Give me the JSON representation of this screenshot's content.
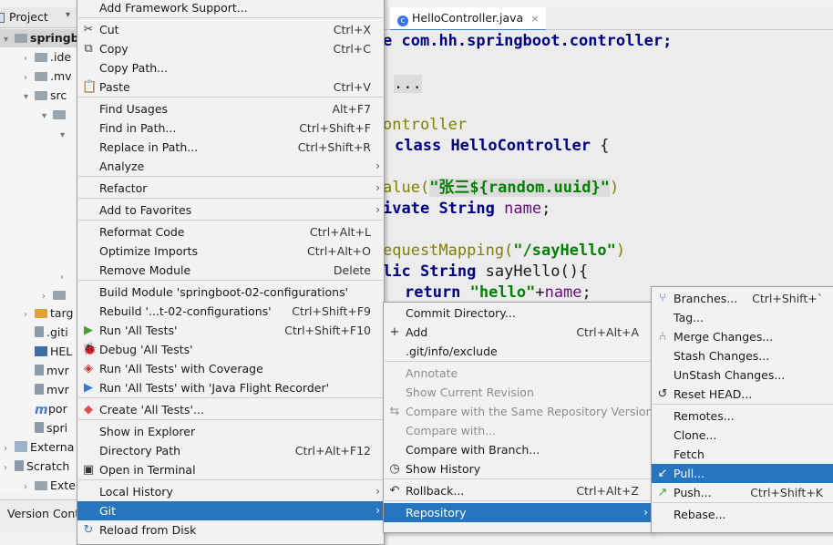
{
  "project_panel": {
    "title": "Project",
    "tree": [
      {
        "label": "springb",
        "arrow": "▾",
        "icon": "folder",
        "bold": true,
        "selected": true
      },
      {
        "label": ".ide",
        "arrow": "›",
        "icon": "folder"
      },
      {
        "label": ".mv",
        "arrow": "›",
        "icon": "folder"
      },
      {
        "label": "src",
        "arrow": "▾",
        "icon": "folder"
      },
      {
        "label": "",
        "arrow": "▾",
        "icon": "folder"
      },
      {
        "label": "",
        "arrow": "▾",
        "icon": ""
      },
      {
        "label": "",
        "arrow": "›",
        "icon": ""
      },
      {
        "label": "",
        "arrow": "›",
        "icon": "folder"
      },
      {
        "label": "targ",
        "arrow": "›",
        "icon": "folder-orange"
      },
      {
        "label": ".giti",
        "arrow": "",
        "icon": "file"
      },
      {
        "label": "HEL",
        "arrow": "",
        "icon": "markdown"
      },
      {
        "label": "mvr",
        "arrow": "",
        "icon": "file"
      },
      {
        "label": "mvr",
        "arrow": "",
        "icon": "file"
      },
      {
        "label": "por",
        "arrow": "",
        "icon": "maven"
      },
      {
        "label": "spri",
        "arrow": "",
        "icon": "file"
      },
      {
        "label": "Externa",
        "arrow": "›",
        "icon": "library"
      },
      {
        "label": "Scratch",
        "arrow": "›",
        "icon": "scratch"
      },
      {
        "label": "Exte",
        "arrow": "›",
        "icon": "folder"
      }
    ],
    "bottom_tab": "Version Cont"
  },
  "editor": {
    "tab_label": "HelloController.java",
    "tab_close": "×",
    "package_kw": "e",
    "package_name": "com.hh.springboot.controller;",
    "import_fold": "...",
    "l1": "ontroller",
    "l2_kw": "class",
    "l2_name": "HelloController",
    "l2_brace": "{",
    "l3_ann": "alue(",
    "l3_str": "\"张三${random.uuid}\"",
    "l3_end": ")",
    "l4_kw": "ivate",
    "l4_type": "String",
    "l4_field": "name",
    "l4_end": ";",
    "l5_ann": "equestMapping(",
    "l5_str": "\"/sayHello\"",
    "l5_end": ")",
    "l6_kw": "lic",
    "l6_type": "String",
    "l6_rest": "sayHello(){",
    "l7_kw": "return",
    "l7_str": "\"hello\"",
    "l7_plus": "+",
    "l7_field": "name",
    "l7_end": ";"
  },
  "context_menu": {
    "items": [
      {
        "label": "Add Framework Support...",
        "shortcut": "",
        "icon": ""
      },
      {
        "label": "Cut",
        "shortcut": "Ctrl+X",
        "icon": "scissors-icon"
      },
      {
        "label": "Copy",
        "shortcut": "Ctrl+C",
        "icon": "copy-icon"
      },
      {
        "label": "Copy Path...",
        "shortcut": "",
        "icon": ""
      },
      {
        "label": "Paste",
        "shortcut": "Ctrl+V",
        "icon": "paste-icon"
      },
      {
        "label": "Find Usages",
        "shortcut": "Alt+F7",
        "icon": ""
      },
      {
        "label": "Find in Path...",
        "shortcut": "Ctrl+Shift+F",
        "icon": ""
      },
      {
        "label": "Replace in Path...",
        "shortcut": "Ctrl+Shift+R",
        "icon": ""
      },
      {
        "label": "Analyze",
        "shortcut": "",
        "icon": "",
        "submenu": true
      },
      {
        "label": "Refactor",
        "shortcut": "",
        "icon": "",
        "submenu": true
      },
      {
        "label": "Add to Favorites",
        "shortcut": "",
        "icon": "",
        "submenu": true
      },
      {
        "label": "Reformat Code",
        "shortcut": "Ctrl+Alt+L",
        "icon": ""
      },
      {
        "label": "Optimize Imports",
        "shortcut": "Ctrl+Alt+O",
        "icon": ""
      },
      {
        "label": "Remove Module",
        "shortcut": "Delete",
        "icon": ""
      },
      {
        "label": "Build Module 'springboot-02-configurations'",
        "shortcut": "",
        "icon": ""
      },
      {
        "label": "Rebuild '...t-02-configurations'",
        "shortcut": "Ctrl+Shift+F9",
        "icon": ""
      },
      {
        "label": "Run 'All Tests'",
        "shortcut": "Ctrl+Shift+F10",
        "icon": "run-icon"
      },
      {
        "label": "Debug 'All Tests'",
        "shortcut": "",
        "icon": "debug-icon"
      },
      {
        "label": "Run 'All Tests' with Coverage",
        "shortcut": "",
        "icon": "coverage-icon"
      },
      {
        "label": "Run 'All Tests' with 'Java Flight Recorder'",
        "shortcut": "",
        "icon": "flight-recorder-icon"
      },
      {
        "label": "Create 'All Tests'...",
        "shortcut": "",
        "icon": "create-config-icon"
      },
      {
        "label": "Show in Explorer",
        "shortcut": "",
        "icon": ""
      },
      {
        "label": "Directory Path",
        "shortcut": "Ctrl+Alt+F12",
        "icon": ""
      },
      {
        "label": "Open in Terminal",
        "shortcut": "",
        "icon": "terminal-icon"
      },
      {
        "label": "Local History",
        "shortcut": "",
        "icon": "",
        "submenu": true
      },
      {
        "label": "Git",
        "shortcut": "",
        "icon": "",
        "submenu": true,
        "selected": true
      },
      {
        "label": "Reload from Disk",
        "shortcut": "",
        "icon": "reload-icon"
      }
    ]
  },
  "git_menu": {
    "items": [
      {
        "label": "Commit Directory...",
        "shortcut": "",
        "icon": ""
      },
      {
        "label": "Add",
        "shortcut": "Ctrl+Alt+A",
        "icon": "plus-icon"
      },
      {
        "label": ".git/info/exclude",
        "shortcut": "",
        "icon": ""
      },
      {
        "label": "Annotate",
        "shortcut": "",
        "icon": "",
        "disabled": true
      },
      {
        "label": "Show Current Revision",
        "shortcut": "",
        "icon": "",
        "disabled": true
      },
      {
        "label": "Compare with the Same Repository Version",
        "shortcut": "",
        "icon": "compare-icon",
        "disabled": true
      },
      {
        "label": "Compare with...",
        "shortcut": "",
        "icon": "",
        "disabled": true
      },
      {
        "label": "Compare with Branch...",
        "shortcut": "",
        "icon": ""
      },
      {
        "label": "Show History",
        "shortcut": "",
        "icon": "history-icon"
      },
      {
        "label": "Rollback...",
        "shortcut": "Ctrl+Alt+Z",
        "icon": "rollback-icon"
      },
      {
        "label": "Repository",
        "shortcut": "",
        "icon": "",
        "submenu": true,
        "selected": true
      }
    ]
  },
  "repository_menu": {
    "items": [
      {
        "label": "Branches...",
        "shortcut": "Ctrl+Shift+`",
        "icon": "branch-icon"
      },
      {
        "label": "Tag...",
        "shortcut": "",
        "icon": ""
      },
      {
        "label": "Merge Changes...",
        "shortcut": "",
        "icon": "merge-icon"
      },
      {
        "label": "Stash Changes...",
        "shortcut": "",
        "icon": ""
      },
      {
        "label": "UnStash Changes...",
        "shortcut": "",
        "icon": ""
      },
      {
        "label": "Reset HEAD...",
        "shortcut": "",
        "icon": "reset-icon"
      },
      {
        "label": "Remotes...",
        "shortcut": "",
        "icon": ""
      },
      {
        "label": "Clone...",
        "shortcut": "",
        "icon": ""
      },
      {
        "label": "Fetch",
        "shortcut": "",
        "icon": ""
      },
      {
        "label": "Pull...",
        "shortcut": "",
        "icon": "pull-icon",
        "selected": true
      },
      {
        "label": "Push...",
        "shortcut": "Ctrl+Shift+K",
        "icon": "push-icon"
      },
      {
        "label": "Rebase...",
        "shortcut": "",
        "icon": ""
      }
    ]
  },
  "colors": {
    "selection": "#2675bf",
    "menu_bg": "#f2f2f2",
    "disabled_text": "#8c8c8c"
  }
}
